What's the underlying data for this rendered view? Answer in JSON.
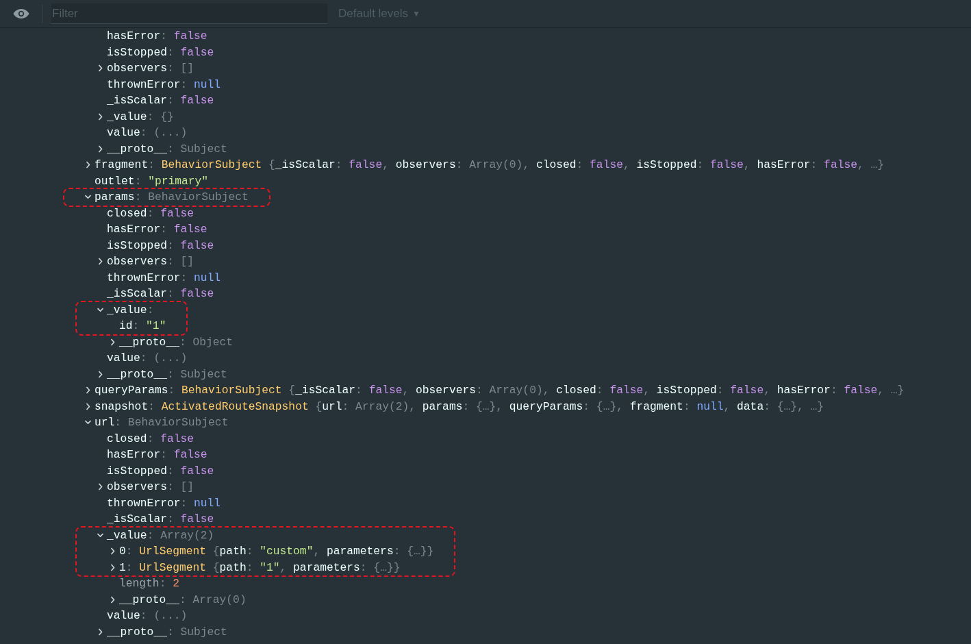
{
  "toolbar": {
    "filter": {
      "placeholder": "Filter"
    },
    "levels": {
      "label": "Default levels",
      "caret": "▼"
    }
  },
  "tree": [
    {
      "kind": "offscreen",
      "children": [
        {
          "parts": [
            {
              "kind": "key",
              "text": "hasError"
            },
            {
              "kind": "punct",
              "text": ": "
            },
            {
              "kind": "bool",
              "text": "false"
            }
          ]
        },
        {
          "parts": [
            {
              "kind": "key",
              "text": "isStopped"
            },
            {
              "kind": "punct",
              "text": ": "
            },
            {
              "kind": "bool",
              "text": "false"
            }
          ]
        },
        {
          "expanded": false,
          "parts": [
            {
              "kind": "key",
              "text": "observers"
            },
            {
              "kind": "punct",
              "text": ": "
            },
            {
              "kind": "dim",
              "text": "[]"
            }
          ]
        },
        {
          "parts": [
            {
              "kind": "key",
              "text": "thrownError"
            },
            {
              "kind": "punct",
              "text": ": "
            },
            {
              "kind": "null",
              "text": "null"
            }
          ]
        },
        {
          "parts": [
            {
              "kind": "key",
              "text": "_isScalar"
            },
            {
              "kind": "punct",
              "text": ": "
            },
            {
              "kind": "bool",
              "text": "false"
            }
          ]
        },
        {
          "expanded": false,
          "parts": [
            {
              "kind": "key",
              "text": "_value"
            },
            {
              "kind": "punct",
              "text": ": "
            },
            {
              "kind": "dim",
              "text": "{}"
            }
          ]
        },
        {
          "parts": [
            {
              "kind": "key",
              "text": "value"
            },
            {
              "kind": "punct",
              "text": ": "
            },
            {
              "kind": "dim",
              "text": "(...)"
            }
          ]
        },
        {
          "expanded": false,
          "parts": [
            {
              "kind": "key",
              "text": "__proto__"
            },
            {
              "kind": "punct",
              "text": ": "
            },
            {
              "kind": "dim",
              "text": "Subject"
            }
          ]
        }
      ]
    },
    {
      "kind": "entry",
      "expanded": false,
      "parts": [
        {
          "kind": "key",
          "text": "fragment"
        },
        {
          "kind": "punct",
          "text": ": "
        },
        {
          "kind": "class",
          "text": "BehaviorSubject"
        },
        {
          "kind": "dim",
          "text": " {"
        },
        {
          "kind": "key",
          "text": "_isScalar"
        },
        {
          "kind": "punct",
          "text": ": "
        },
        {
          "kind": "bool",
          "text": "false"
        },
        {
          "kind": "punct",
          "text": ", "
        },
        {
          "kind": "key",
          "text": "observers"
        },
        {
          "kind": "punct",
          "text": ": "
        },
        {
          "kind": "dim",
          "text": "Array(0)"
        },
        {
          "kind": "punct",
          "text": ", "
        },
        {
          "kind": "key",
          "text": "closed"
        },
        {
          "kind": "punct",
          "text": ": "
        },
        {
          "kind": "bool",
          "text": "false"
        },
        {
          "kind": "punct",
          "text": ", "
        },
        {
          "kind": "key",
          "text": "isStopped"
        },
        {
          "kind": "punct",
          "text": ": "
        },
        {
          "kind": "bool",
          "text": "false"
        },
        {
          "kind": "punct",
          "text": ", "
        },
        {
          "kind": "key",
          "text": "hasError"
        },
        {
          "kind": "punct",
          "text": ": "
        },
        {
          "kind": "bool",
          "text": "false"
        },
        {
          "kind": "punct",
          "text": ", "
        },
        {
          "kind": "dim",
          "text": "…}"
        }
      ]
    },
    {
      "kind": "entry",
      "parts": [
        {
          "kind": "key",
          "text": "outlet"
        },
        {
          "kind": "punct",
          "text": ": "
        },
        {
          "kind": "string",
          "text": "\"primary\""
        }
      ]
    },
    {
      "kind": "entry",
      "expanded": true,
      "highlighted": true,
      "parts": [
        {
          "kind": "key",
          "text": "params"
        },
        {
          "kind": "punct",
          "text": ": "
        },
        {
          "kind": "dim",
          "text": "BehaviorSubject"
        }
      ],
      "children": [
        {
          "parts": [
            {
              "kind": "key",
              "text": "closed"
            },
            {
              "kind": "punct",
              "text": ": "
            },
            {
              "kind": "bool",
              "text": "false"
            }
          ]
        },
        {
          "parts": [
            {
              "kind": "key",
              "text": "hasError"
            },
            {
              "kind": "punct",
              "text": ": "
            },
            {
              "kind": "bool",
              "text": "false"
            }
          ]
        },
        {
          "parts": [
            {
              "kind": "key",
              "text": "isStopped"
            },
            {
              "kind": "punct",
              "text": ": "
            },
            {
              "kind": "bool",
              "text": "false"
            }
          ]
        },
        {
          "expanded": false,
          "parts": [
            {
              "kind": "key",
              "text": "observers"
            },
            {
              "kind": "punct",
              "text": ": "
            },
            {
              "kind": "dim",
              "text": "[]"
            }
          ]
        },
        {
          "parts": [
            {
              "kind": "key",
              "text": "thrownError"
            },
            {
              "kind": "punct",
              "text": ": "
            },
            {
              "kind": "null",
              "text": "null"
            }
          ]
        },
        {
          "parts": [
            {
              "kind": "key",
              "text": "_isScalar"
            },
            {
              "kind": "punct",
              "text": ": "
            },
            {
              "kind": "bool",
              "text": "false"
            }
          ]
        },
        {
          "expanded": true,
          "highlighted": true,
          "parts": [
            {
              "kind": "key",
              "text": "_value"
            },
            {
              "kind": "punct",
              "text": ":"
            }
          ],
          "children": [
            {
              "highlighted": true,
              "parts": [
                {
                  "kind": "key",
                  "text": "id"
                },
                {
                  "kind": "punct",
                  "text": ": "
                },
                {
                  "kind": "string",
                  "text": "\"1\""
                }
              ]
            },
            {
              "expanded": false,
              "parts": [
                {
                  "kind": "key",
                  "text": "__proto__"
                },
                {
                  "kind": "punct",
                  "text": ": "
                },
                {
                  "kind": "dim",
                  "text": "Object"
                }
              ]
            }
          ]
        },
        {
          "parts": [
            {
              "kind": "key",
              "text": "value"
            },
            {
              "kind": "punct",
              "text": ": "
            },
            {
              "kind": "dim",
              "text": "(...)"
            }
          ]
        },
        {
          "expanded": false,
          "parts": [
            {
              "kind": "key",
              "text": "__proto__"
            },
            {
              "kind": "punct",
              "text": ": "
            },
            {
              "kind": "dim",
              "text": "Subject"
            }
          ]
        }
      ]
    },
    {
      "kind": "entry",
      "expanded": false,
      "parts": [
        {
          "kind": "key",
          "text": "queryParams"
        },
        {
          "kind": "punct",
          "text": ": "
        },
        {
          "kind": "class",
          "text": "BehaviorSubject"
        },
        {
          "kind": "dim",
          "text": " {"
        },
        {
          "kind": "key",
          "text": "_isScalar"
        },
        {
          "kind": "punct",
          "text": ": "
        },
        {
          "kind": "bool",
          "text": "false"
        },
        {
          "kind": "punct",
          "text": ", "
        },
        {
          "kind": "key",
          "text": "observers"
        },
        {
          "kind": "punct",
          "text": ": "
        },
        {
          "kind": "dim",
          "text": "Array(0)"
        },
        {
          "kind": "punct",
          "text": ", "
        },
        {
          "kind": "key",
          "text": "closed"
        },
        {
          "kind": "punct",
          "text": ": "
        },
        {
          "kind": "bool",
          "text": "false"
        },
        {
          "kind": "punct",
          "text": ", "
        },
        {
          "kind": "key",
          "text": "isStopped"
        },
        {
          "kind": "punct",
          "text": ": "
        },
        {
          "kind": "bool",
          "text": "false"
        },
        {
          "kind": "punct",
          "text": ", "
        },
        {
          "kind": "key",
          "text": "hasError"
        },
        {
          "kind": "punct",
          "text": ": "
        },
        {
          "kind": "bool",
          "text": "false"
        },
        {
          "kind": "punct",
          "text": ", "
        },
        {
          "kind": "dim",
          "text": "…}"
        }
      ]
    },
    {
      "kind": "entry",
      "expanded": false,
      "parts": [
        {
          "kind": "key",
          "text": "snapshot"
        },
        {
          "kind": "punct",
          "text": ": "
        },
        {
          "kind": "class",
          "text": "ActivatedRouteSnapshot"
        },
        {
          "kind": "dim",
          "text": " {"
        },
        {
          "kind": "key",
          "text": "url"
        },
        {
          "kind": "punct",
          "text": ": "
        },
        {
          "kind": "dim",
          "text": "Array(2)"
        },
        {
          "kind": "punct",
          "text": ", "
        },
        {
          "kind": "key",
          "text": "params"
        },
        {
          "kind": "punct",
          "text": ": "
        },
        {
          "kind": "dim",
          "text": "{…}"
        },
        {
          "kind": "punct",
          "text": ", "
        },
        {
          "kind": "key",
          "text": "queryParams"
        },
        {
          "kind": "punct",
          "text": ": "
        },
        {
          "kind": "dim",
          "text": "{…}"
        },
        {
          "kind": "punct",
          "text": ", "
        },
        {
          "kind": "key",
          "text": "fragment"
        },
        {
          "kind": "punct",
          "text": ": "
        },
        {
          "kind": "null",
          "text": "null"
        },
        {
          "kind": "punct",
          "text": ", "
        },
        {
          "kind": "key",
          "text": "data"
        },
        {
          "kind": "punct",
          "text": ": "
        },
        {
          "kind": "dim",
          "text": "{…}, …}"
        }
      ]
    },
    {
      "kind": "entry",
      "expanded": true,
      "parts": [
        {
          "kind": "key",
          "text": "url"
        },
        {
          "kind": "punct",
          "text": ": "
        },
        {
          "kind": "dim",
          "text": "BehaviorSubject"
        }
      ],
      "children": [
        {
          "parts": [
            {
              "kind": "key",
              "text": "closed"
            },
            {
              "kind": "punct",
              "text": ": "
            },
            {
              "kind": "bool",
              "text": "false"
            }
          ]
        },
        {
          "parts": [
            {
              "kind": "key",
              "text": "hasError"
            },
            {
              "kind": "punct",
              "text": ": "
            },
            {
              "kind": "bool",
              "text": "false"
            }
          ]
        },
        {
          "parts": [
            {
              "kind": "key",
              "text": "isStopped"
            },
            {
              "kind": "punct",
              "text": ": "
            },
            {
              "kind": "bool",
              "text": "false"
            }
          ]
        },
        {
          "expanded": false,
          "parts": [
            {
              "kind": "key",
              "text": "observers"
            },
            {
              "kind": "punct",
              "text": ": "
            },
            {
              "kind": "dim",
              "text": "[]"
            }
          ]
        },
        {
          "parts": [
            {
              "kind": "key",
              "text": "thrownError"
            },
            {
              "kind": "punct",
              "text": ": "
            },
            {
              "kind": "null",
              "text": "null"
            }
          ]
        },
        {
          "parts": [
            {
              "kind": "key",
              "text": "_isScalar"
            },
            {
              "kind": "punct",
              "text": ": "
            },
            {
              "kind": "bool",
              "text": "false"
            }
          ]
        },
        {
          "expanded": true,
          "highlighted": true,
          "parts": [
            {
              "kind": "key",
              "text": "_value"
            },
            {
              "kind": "punct",
              "text": ": "
            },
            {
              "kind": "dim",
              "text": "Array(2)"
            }
          ],
          "children": [
            {
              "expanded": false,
              "highlighted": true,
              "parts": [
                {
                  "kind": "key",
                  "text": "0"
                },
                {
                  "kind": "punct",
                  "text": ": "
                },
                {
                  "kind": "class",
                  "text": "UrlSegment"
                },
                {
                  "kind": "dim",
                  "text": " {"
                },
                {
                  "kind": "key",
                  "text": "path"
                },
                {
                  "kind": "punct",
                  "text": ": "
                },
                {
                  "kind": "string",
                  "text": "\"custom\""
                },
                {
                  "kind": "punct",
                  "text": ", "
                },
                {
                  "kind": "key",
                  "text": "parameters"
                },
                {
                  "kind": "punct",
                  "text": ": "
                },
                {
                  "kind": "dim",
                  "text": "{…}}"
                }
              ]
            },
            {
              "expanded": false,
              "highlighted": true,
              "parts": [
                {
                  "kind": "key",
                  "text": "1"
                },
                {
                  "kind": "punct",
                  "text": ": "
                },
                {
                  "kind": "class",
                  "text": "UrlSegment"
                },
                {
                  "kind": "dim",
                  "text": " {"
                },
                {
                  "kind": "key",
                  "text": "path"
                },
                {
                  "kind": "punct",
                  "text": ": "
                },
                {
                  "kind": "string",
                  "text": "\"1\""
                },
                {
                  "kind": "punct",
                  "text": ", "
                },
                {
                  "kind": "key",
                  "text": "parameters"
                },
                {
                  "kind": "punct",
                  "text": ": "
                },
                {
                  "kind": "dim",
                  "text": "{…}}"
                }
              ]
            },
            {
              "parts": [
                {
                  "kind": "dimkey",
                  "text": "length"
                },
                {
                  "kind": "punct",
                  "text": ": "
                },
                {
                  "kind": "number",
                  "text": "2"
                }
              ]
            },
            {
              "expanded": false,
              "parts": [
                {
                  "kind": "key",
                  "text": "__proto__"
                },
                {
                  "kind": "punct",
                  "text": ": "
                },
                {
                  "kind": "dim",
                  "text": "Array(0)"
                }
              ]
            }
          ]
        },
        {
          "parts": [
            {
              "kind": "key",
              "text": "value"
            },
            {
              "kind": "punct",
              "text": ": "
            },
            {
              "kind": "dim",
              "text": "(...)"
            }
          ]
        },
        {
          "expanded": false,
          "parts": [
            {
              "kind": "key",
              "text": "__proto__"
            },
            {
              "kind": "punct",
              "text": ": "
            },
            {
              "kind": "dim",
              "text": "Subject"
            }
          ]
        }
      ]
    }
  ]
}
